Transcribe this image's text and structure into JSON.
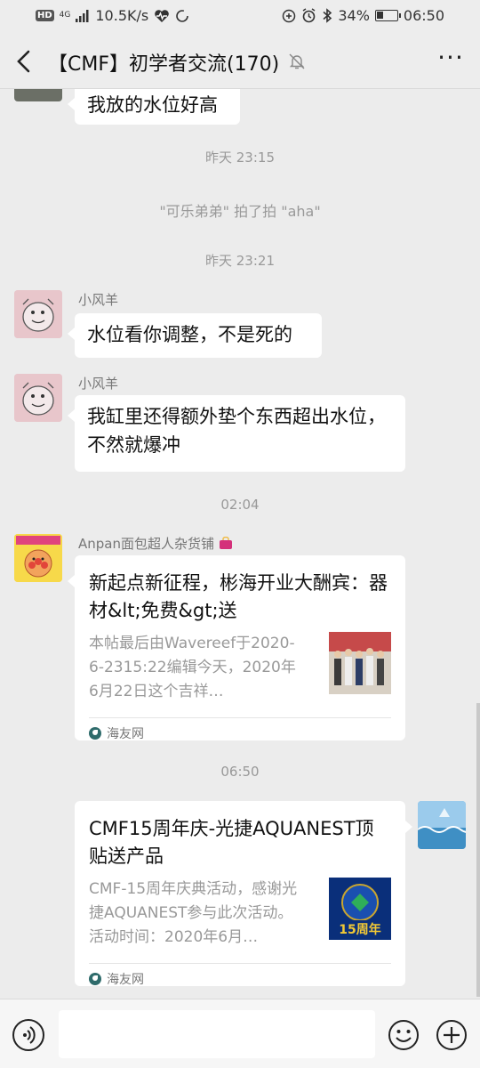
{
  "status_bar": {
    "hd": "HD",
    "network": "4G",
    "speed": "10.5K/s",
    "battery": "34%",
    "battery_level": 0.34,
    "time": "06:50"
  },
  "header": {
    "title": "【CMF】初学者交流(170)",
    "back_icon": "chevron-left-icon",
    "mute_icon": "bell-muted-icon",
    "more_icon": "more-icon",
    "more_label": "···"
  },
  "messages": {
    "m1": {
      "text": "我放的水位好高"
    },
    "t1": "昨天 23:15",
    "sys1": "\"可乐弟弟\" 拍了拍 \"aha\"",
    "t2": "昨天 23:21",
    "m2": {
      "sender": "小风羊",
      "text": "水位看你调整，不是死的"
    },
    "m3": {
      "sender": "小风羊",
      "text": "我缸里还得额外垫个东西超出水位，不然就爆冲"
    },
    "t3": "02:04",
    "m4": {
      "sender": "Anpan面包超人杂货铺",
      "card_title": "新起点新征程，彬海开业大酬宾：器材&lt;免费&gt;送",
      "card_desc": "本帖最后由Wavereef于2020-6-2315:22编辑今天，2020年6月22日这个吉祥…",
      "source": "海友网"
    },
    "t4": "06:50",
    "m5": {
      "card_title": "CMF15周年庆-光捷AQUANEST顶贴送产品",
      "card_desc": "CMF-15周年庆典活动，感谢光捷AQUANEST参与此次活动。活动时间：2020年6月…",
      "thumb_label": "15周年",
      "source": "海友网"
    }
  },
  "input_bar": {
    "voice_icon": "voice-icon",
    "emoji_icon": "emoji-icon",
    "plus_icon": "plus-icon"
  }
}
